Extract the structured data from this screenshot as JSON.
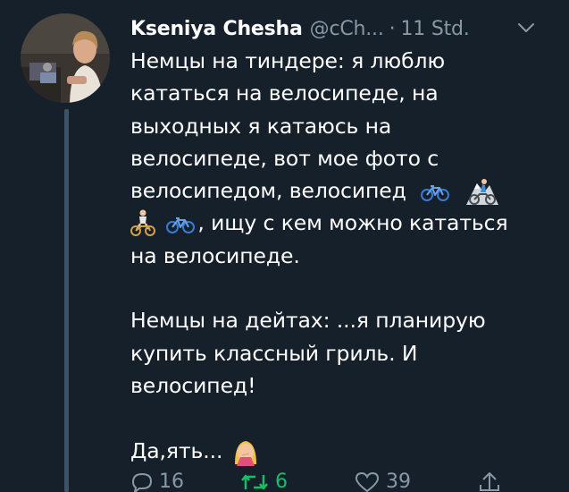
{
  "tweet": {
    "author": {
      "display_name": "Kseniya Chesha",
      "handle": "@cCh...",
      "avatar_icon": "avatar-photo"
    },
    "separator": "·",
    "timestamp": "11 Std.",
    "menu_icon": "chevron-down-icon",
    "text_lines": {
      "l1": "Немцы на тиндере: я люблю",
      "l2": "кататься на велосипеде, на",
      "l3": "выходных я катаюсь на",
      "l4": "велосипеде, вот мое фото с",
      "l5": "велосипедом, велосипед",
      "l6": ", ищу с кем можно кататься",
      "l7": "на велосипеде.",
      "l8": "Немцы на дейтах: ...я планирую",
      "l9": "купить классный гриль. И",
      "l10": "велосипед!",
      "l11": "Да,ять..."
    },
    "emojis": [
      "bicycle-emoji",
      "mountain-biker-emoji",
      "cyclist-emoji",
      "bicycle-emoji",
      "face-palm-emoji"
    ],
    "actions": {
      "reply_count": "16",
      "retweet_count": "6",
      "like_count": "39"
    },
    "colors": {
      "background": "#15202b",
      "text": "#ffffff",
      "secondary": "#8899a6",
      "retweet_active": "#17bf63",
      "thread_line": "#3d5466"
    }
  }
}
